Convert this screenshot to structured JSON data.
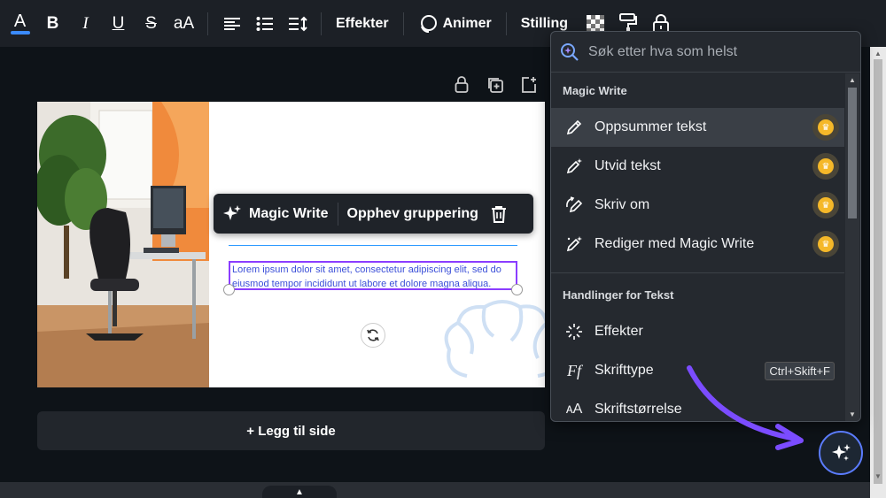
{
  "toolbar": {
    "effects_label": "Effekter",
    "animate_label": "Animer",
    "position_label": "Stilling",
    "text_color_glyph": "A",
    "bold_glyph": "B",
    "italic_glyph": "I",
    "underline_glyph": "U",
    "strike_glyph": "S",
    "case_glyph": "aA"
  },
  "context_menu": {
    "magic_write_label": "Magic Write",
    "ungroup_label": "Opphev gruppering"
  },
  "canvas": {
    "body_text": "Lorem ipsum dolor sit amet, consectetur adipiscing elit, sed do eiusmod tempor incididunt ut labore et dolore magna aliqua.",
    "add_page_label": "+ Legg til side"
  },
  "panel": {
    "search_placeholder": "Søk etter hva som helst",
    "section_magic_write": "Magic Write",
    "magic_items": [
      {
        "label": "Oppsummer tekst",
        "icon": "pencil-icon"
      },
      {
        "label": "Utvid tekst",
        "icon": "wand-pencil-icon"
      },
      {
        "label": "Skriv om",
        "icon": "rewrite-icon"
      },
      {
        "label": "Rediger med Magic Write",
        "icon": "magic-edit-icon"
      }
    ],
    "section_text_actions": "Handlinger for Tekst",
    "text_items": [
      {
        "label": "Effekter",
        "icon": "sparkle-burst-icon"
      },
      {
        "label": "Skrifttype",
        "icon": "font-icon",
        "shortcut": "Ctrl+Skift+F"
      },
      {
        "label": "Skriftstørrelse",
        "icon": "font-size-icon"
      }
    ]
  },
  "colors": {
    "accent_purple": "#8b3dff",
    "crown_gold": "#f5b829",
    "panel_bg": "#25292f",
    "toolbar_bg": "#1c2026",
    "arrow_purple": "#7b4cff"
  }
}
